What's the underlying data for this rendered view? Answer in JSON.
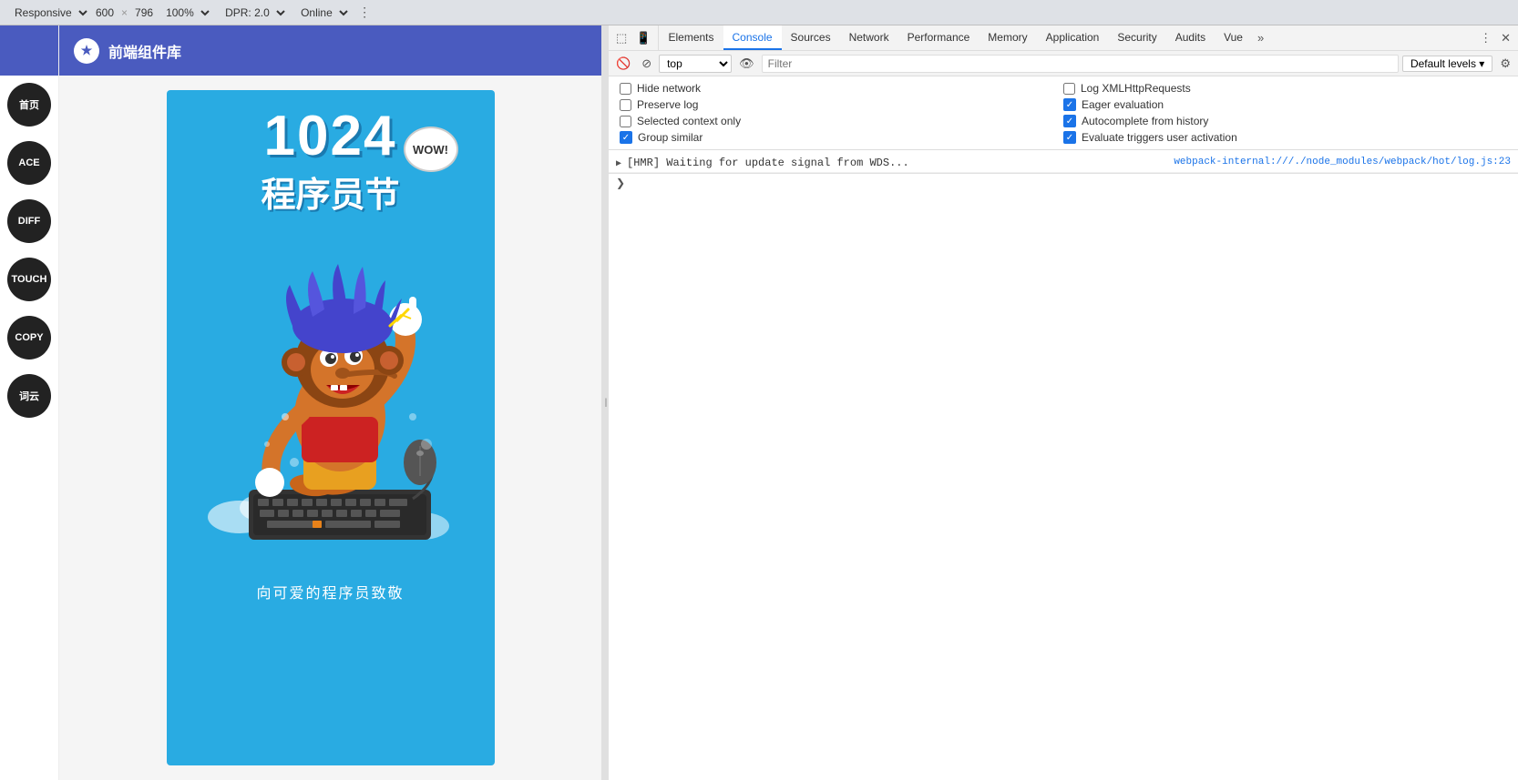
{
  "browser_toolbar": {
    "responsive_label": "Responsive",
    "width": "600",
    "x": "×",
    "height": "796",
    "zoom": "100%",
    "dpr_label": "DPR: 2.0",
    "online_label": "Online"
  },
  "app": {
    "header_icon": "★",
    "header_title": "前端组件库",
    "nav_items": [
      {
        "label": "首页",
        "id": "home"
      },
      {
        "label": "ACE",
        "id": "ace"
      },
      {
        "label": "DIFF",
        "id": "diff"
      },
      {
        "label": "TOUCH",
        "id": "touch"
      },
      {
        "label": "COPY",
        "id": "copy"
      },
      {
        "label": "词云",
        "id": "wordcloud"
      }
    ],
    "poster": {
      "title": "1024",
      "subtitle": "程序员节",
      "wow_text": "WOW!",
      "bottom_text": "向可爱的程序员致敬"
    }
  },
  "devtools": {
    "tabs": [
      {
        "label": "Elements",
        "id": "elements",
        "active": false
      },
      {
        "label": "Console",
        "id": "console",
        "active": true
      },
      {
        "label": "Sources",
        "id": "sources",
        "active": false
      },
      {
        "label": "Network",
        "id": "network",
        "active": false
      },
      {
        "label": "Performance",
        "id": "performance",
        "active": false
      },
      {
        "label": "Memory",
        "id": "memory",
        "active": false
      },
      {
        "label": "Application",
        "id": "application",
        "active": false
      },
      {
        "label": "Security",
        "id": "security",
        "active": false
      },
      {
        "label": "Audits",
        "id": "audits",
        "active": false
      },
      {
        "label": "Vue",
        "id": "vue",
        "active": false
      }
    ],
    "console": {
      "context_value": "top",
      "filter_placeholder": "Filter",
      "levels_label": "Default levels ▾",
      "settings": {
        "left": [
          {
            "label": "Hide network",
            "checked": false
          },
          {
            "label": "Preserve log",
            "checked": false
          },
          {
            "label": "Selected context only",
            "checked": false
          },
          {
            "label": "Group similar",
            "checked": true
          }
        ],
        "right": [
          {
            "label": "Log XMLHttpRequests",
            "checked": false
          },
          {
            "label": "Eager evaluation",
            "checked": true
          },
          {
            "label": "Autocomplete from history",
            "checked": true
          },
          {
            "label": "Evaluate triggers user activation",
            "checked": true
          }
        ]
      },
      "log_entries": [
        {
          "text": "[HMR] Waiting for update signal from WDS...",
          "source": "webpack-internal:///./node_modules/webpack/hot/log.js:23",
          "type": "info"
        }
      ]
    }
  }
}
